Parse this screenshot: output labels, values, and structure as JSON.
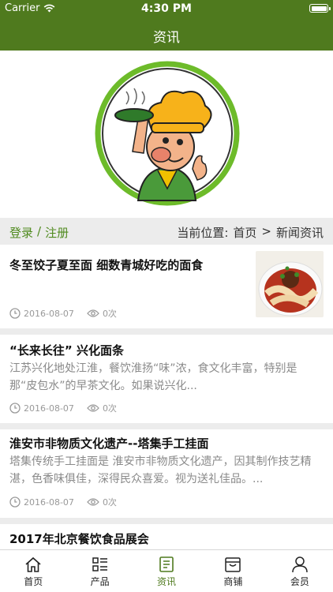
{
  "status_bar": {
    "carrier": "Carrier",
    "time": "4:30 PM",
    "battery_level": 1.0
  },
  "nav": {
    "title": "资讯"
  },
  "auth": {
    "login": "登录",
    "separator": "/",
    "register": "注册"
  },
  "breadcrumb": {
    "prefix": "当前位置:",
    "home": "首页",
    "separator": ">",
    "current": "新闻资讯"
  },
  "articles": [
    {
      "title": "冬至饺子夏至面 细数青城好吃的面食",
      "summary": "",
      "date": "2016-08-07",
      "views": "0次",
      "has_thumbnail": true
    },
    {
      "title": "“长来长往” 兴化面条",
      "summary": " 江苏兴化地处江淮，餐饮淮扬“味”浓，食文化丰富，特别是那“皮包水”的早茶文化。如果说兴化...",
      "date": "2016-08-07",
      "views": "0次",
      "has_thumbnail": false
    },
    {
      "title": "淮安市非物质文化遗产--塔集手工挂面",
      "summary": "塔集传统手工挂面是 淮安市非物质文化遗产，因其制作技艺精湛，色香味俱佳，深得民众喜爱。视为送礼佳品。...",
      "date": "2016-08-07",
      "views": "0次",
      "has_thumbnail": false
    },
    {
      "title": "2017年北京餐饮食品展会",
      "summary": "",
      "date": "",
      "views": "",
      "has_thumbnail": false
    }
  ],
  "tabs": [
    {
      "label": "首页",
      "icon": "home-icon",
      "active": false
    },
    {
      "label": "产品",
      "icon": "list-icon",
      "active": false
    },
    {
      "label": "资讯",
      "icon": "news-icon",
      "active": true
    },
    {
      "label": "商铺",
      "icon": "store-icon",
      "active": false
    },
    {
      "label": "会员",
      "icon": "user-icon",
      "active": false
    }
  ],
  "colors": {
    "accent": "#4f7a1e",
    "link_green": "#4f8a1e",
    "background": "#ececec"
  }
}
